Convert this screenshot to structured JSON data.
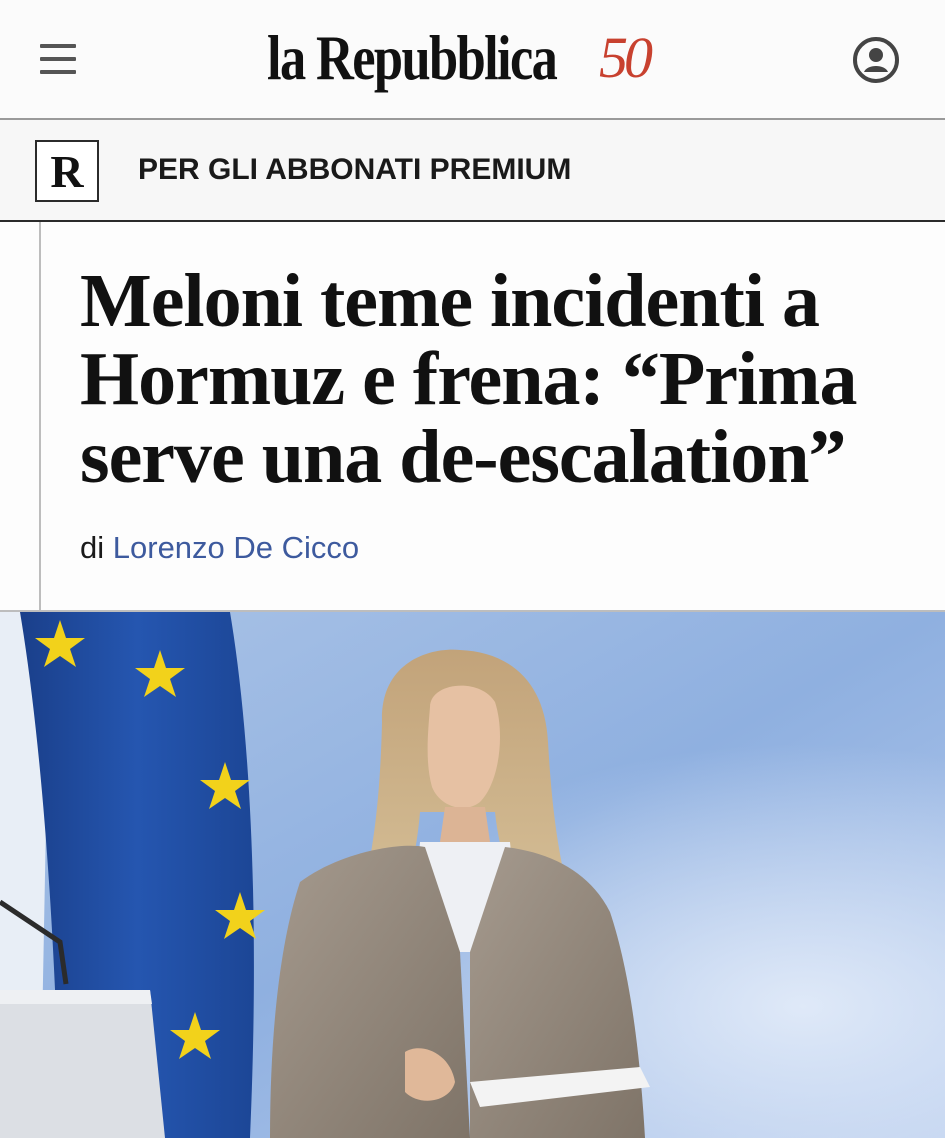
{
  "header": {
    "logo_text": "la Repubblica",
    "logo_anniversary": "50",
    "menu_icon": "hamburger-menu-icon",
    "account_icon": "user-account-icon"
  },
  "premium": {
    "badge_letter": "R",
    "label": "PER GLI ABBONATI PREMIUM"
  },
  "article": {
    "headline_line1": "Meloni teme incidenti a",
    "headline_line2": "Hormuz e frena: “Prima",
    "headline_line3": "serve una de-escalation”",
    "byline_prefix": "di",
    "author": "Lorenzo De Cicco"
  },
  "colors": {
    "brand_accent": "#c8412f",
    "author_link": "#3d5a9e",
    "eu_flag_blue": "#1f4fa3",
    "eu_star_yellow": "#f2d21b"
  }
}
